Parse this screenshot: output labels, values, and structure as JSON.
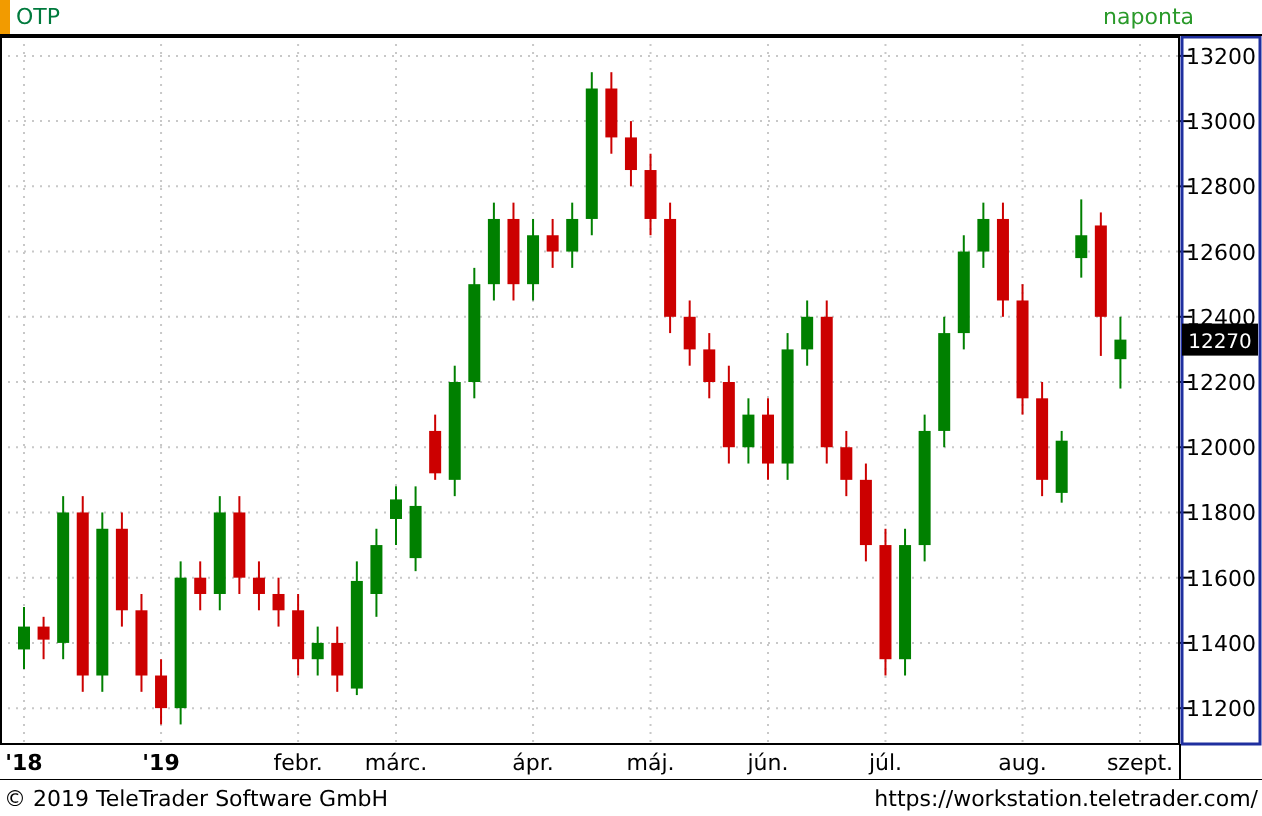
{
  "header": {
    "symbol": "OTP",
    "interval": "naponta"
  },
  "chart": {
    "chart_data": {
      "type": "candlestick",
      "grid": true,
      "ylim": [
        11090,
        13261
      ],
      "yticks": [
        11200,
        11400,
        11600,
        11800,
        12000,
        12200,
        12400,
        12600,
        12800,
        13000,
        13200
      ],
      "categories": [
        "'18",
        null,
        null,
        null,
        null,
        null,
        null,
        "'19",
        null,
        null,
        null,
        null,
        null,
        null,
        "febr.",
        null,
        null,
        null,
        null,
        "márc.",
        null,
        null,
        null,
        null,
        null,
        null,
        "ápr.",
        null,
        null,
        null,
        null,
        null,
        "máj.",
        null,
        null,
        null,
        null,
        null,
        "jún.",
        null,
        null,
        null,
        null,
        null,
        "júl.",
        null,
        null,
        null,
        null,
        null,
        null,
        "aug.",
        null,
        null,
        null,
        null,
        null,
        "szept."
      ],
      "ohlc": [
        [
          11380,
          11510,
          11320,
          11450
        ],
        [
          11450,
          11480,
          11350,
          11410
        ],
        [
          11400,
          11850,
          11350,
          11800
        ],
        [
          11800,
          11850,
          11250,
          11300
        ],
        [
          11300,
          11800,
          11250,
          11750
        ],
        [
          11750,
          11800,
          11450,
          11500
        ],
        [
          11500,
          11550,
          11250,
          11300
        ],
        [
          11300,
          11350,
          11150,
          11200
        ],
        [
          11200,
          11650,
          11150,
          11600
        ],
        [
          11600,
          11650,
          11500,
          11550
        ],
        [
          11550,
          11850,
          11500,
          11800
        ],
        [
          11800,
          11850,
          11550,
          11600
        ],
        [
          11600,
          11650,
          11500,
          11550
        ],
        [
          11550,
          11600,
          11450,
          11500
        ],
        [
          11500,
          11550,
          11300,
          11350
        ],
        [
          11350,
          11450,
          11300,
          11400
        ],
        [
          11400,
          11450,
          11250,
          11300
        ],
        [
          11260,
          11650,
          11240,
          11590
        ],
        [
          11550,
          11750,
          11480,
          11700
        ],
        [
          11780,
          11880,
          11700,
          11840
        ],
        [
          11660,
          11880,
          11620,
          11820
        ],
        [
          12050,
          12100,
          11900,
          11920
        ],
        [
          11900,
          12250,
          11850,
          12200
        ],
        [
          12200,
          12550,
          12150,
          12500
        ],
        [
          12500,
          12750,
          12450,
          12700
        ],
        [
          12700,
          12750,
          12450,
          12500
        ],
        [
          12500,
          12700,
          12450,
          12650
        ],
        [
          12650,
          12700,
          12550,
          12600
        ],
        [
          12600,
          12750,
          12550,
          12700
        ],
        [
          12700,
          13150,
          12650,
          13100
        ],
        [
          13100,
          13150,
          12900,
          12950
        ],
        [
          12950,
          13000,
          12800,
          12850
        ],
        [
          12850,
          12900,
          12650,
          12700
        ],
        [
          12700,
          12750,
          12350,
          12400
        ],
        [
          12400,
          12450,
          12250,
          12300
        ],
        [
          12300,
          12350,
          12150,
          12200
        ],
        [
          12200,
          12250,
          11950,
          12000
        ],
        [
          12000,
          12150,
          11950,
          12100
        ],
        [
          12100,
          12150,
          11900,
          11950
        ],
        [
          11950,
          12350,
          11900,
          12300
        ],
        [
          12300,
          12450,
          12250,
          12400
        ],
        [
          12400,
          12450,
          11950,
          12000
        ],
        [
          12000,
          12050,
          11850,
          11900
        ],
        [
          11900,
          11950,
          11650,
          11700
        ],
        [
          11700,
          11750,
          11300,
          11350
        ],
        [
          11350,
          11750,
          11300,
          11700
        ],
        [
          11700,
          12100,
          11650,
          12050
        ],
        [
          12050,
          12400,
          12000,
          12350
        ],
        [
          12350,
          12650,
          12300,
          12600
        ],
        [
          12600,
          12750,
          12550,
          12700
        ],
        [
          12700,
          12750,
          12400,
          12450
        ],
        [
          12450,
          12500,
          12100,
          12150
        ],
        [
          12150,
          12200,
          11850,
          11900
        ],
        [
          11860,
          12050,
          11830,
          12020
        ],
        [
          12580,
          12760,
          12520,
          12650
        ],
        [
          12680,
          12720,
          12280,
          12400
        ],
        [
          12270,
          12400,
          12180,
          12330
        ],
        null
      ]
    },
    "last_price": "12270"
  },
  "footer": {
    "copyright": "© 2019 TeleTrader Software GmbH",
    "url": "https://workstation.teletrader.com/"
  }
}
